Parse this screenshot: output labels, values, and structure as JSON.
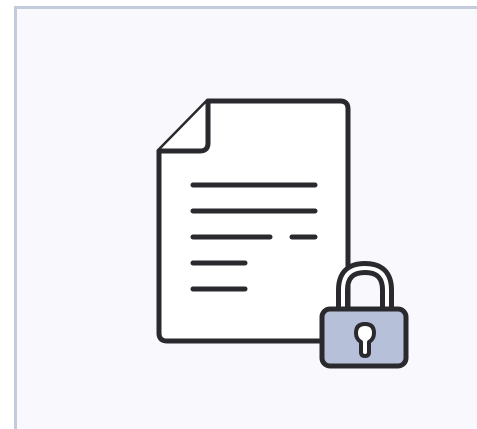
{
  "tile": {
    "background": "#f8f8fd",
    "border_color": "#c3cbdd"
  },
  "icon": {
    "name": "locked-document-icon",
    "stroke_color": "#2a2a2e",
    "paper_color": "#ffffff",
    "lock_body_color": "#b6c0d9"
  }
}
